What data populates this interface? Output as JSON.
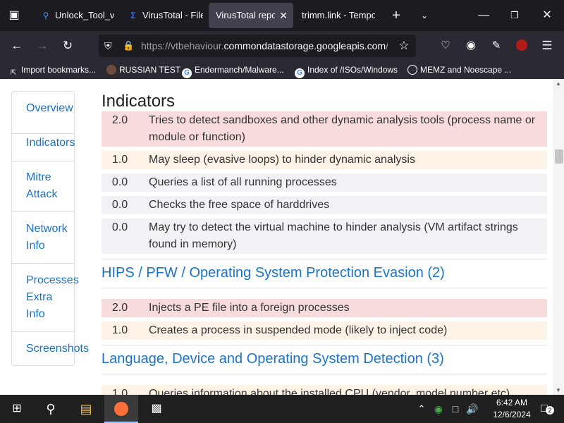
{
  "tabs": [
    {
      "title": "Unlock_Tool_v",
      "icon": "search-icon"
    },
    {
      "title": "VirusTotal - File",
      "icon": "virustotal-icon"
    },
    {
      "title": "VirusTotal report",
      "icon": ""
    },
    {
      "title": "trimm.link - Tempo",
      "icon": ""
    }
  ],
  "nav": {
    "url_prefix": "https://vtbehaviour.",
    "url_domain": "commondatastorage.googleapis.com",
    "url_suffix": "/"
  },
  "bookmarks": [
    {
      "label": "Import bookmarks..."
    },
    {
      "label": "RUSSIAN TEST"
    },
    {
      "label": "Endermanch/Malware..."
    },
    {
      "label": "Index of /ISOs/Windows"
    },
    {
      "label": "MEMZ and Noescape ..."
    }
  ],
  "sidebar": [
    {
      "label": "Overview"
    },
    {
      "label": "Indicators"
    },
    {
      "label": "Mitre Attack"
    },
    {
      "label": "Network Info"
    },
    {
      "label": "Processes Extra Info"
    },
    {
      "label": "Screenshots"
    }
  ],
  "main": {
    "heading": "Indicators",
    "rows_a": [
      {
        "score": "2.0",
        "text": "Tries to detect sandboxes and other dynamic analysis tools (process name or module or function)"
      },
      {
        "score": "1.0",
        "text": "May sleep (evasive loops) to hinder dynamic analysis"
      },
      {
        "score": "0.0",
        "text": "Queries a list of all running processes"
      },
      {
        "score": "0.0",
        "text": "Checks the free space of harddrives"
      },
      {
        "score": "0.0",
        "text": "May try to detect the virtual machine to hinder analysis (VM artifact strings found in memory)"
      }
    ],
    "section_b": "HIPS / PFW / Operating System Protection Evasion (2)",
    "rows_b": [
      {
        "score": "2.0",
        "text": "Injects a PE file into a foreign processes"
      },
      {
        "score": "1.0",
        "text": "Creates a process in suspended mode (likely to inject code)"
      }
    ],
    "section_c": "Language, Device and Operating System Detection (3)",
    "rows_c": [
      {
        "score": "1.0",
        "text": "Queries information about the installed CPU (vendor, model number etc)"
      }
    ]
  },
  "taskbar": {
    "time": "6:42 AM",
    "date": "12/6/2024",
    "notifications": "2"
  }
}
